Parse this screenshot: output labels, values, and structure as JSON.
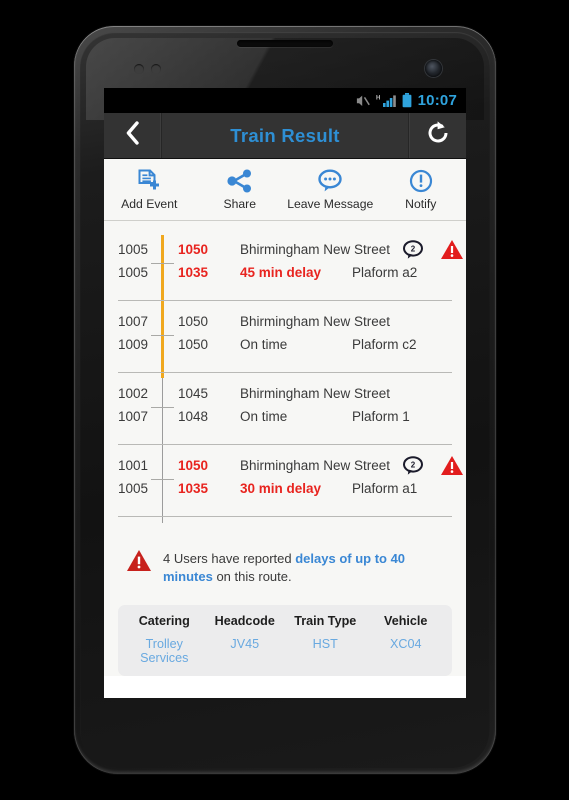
{
  "status_bar": {
    "mute_icon": "mute-icon",
    "signal_icon": "signal-bars-h-icon",
    "battery_icon": "battery-icon",
    "clock": "10:07"
  },
  "nav_bar": {
    "back_icon": "chevron-left-icon",
    "title": "Train Result",
    "refresh_icon": "refresh-icon"
  },
  "toolbar": {
    "items": [
      {
        "label": "Add Event",
        "icon": "document-add-icon"
      },
      {
        "label": "Share",
        "icon": "share-icon"
      },
      {
        "label": "Leave Message",
        "icon": "message-bubble-icon"
      },
      {
        "label": "Notify",
        "icon": "alert-circle-icon"
      }
    ]
  },
  "results": [
    {
      "scheduled_arrival": "1005",
      "estimated_arrival": "1050",
      "destination": "Bhirmingham New Street",
      "scheduled_departure": "1005",
      "estimated_departure": "1035",
      "status": "45 min delay",
      "platform": "Plaform a2",
      "delayed": true,
      "message_count": "2",
      "has_warning": true
    },
    {
      "scheduled_arrival": "1007",
      "estimated_arrival": "1050",
      "destination": "Bhirmingham New Street",
      "scheduled_departure": "1009",
      "estimated_departure": "1050",
      "status": "On time",
      "platform": "Plaform c2",
      "delayed": false,
      "message_count": "",
      "has_warning": false
    },
    {
      "scheduled_arrival": "1002",
      "estimated_arrival": "1045",
      "destination": "Bhirmingham New Street",
      "scheduled_departure": "1007",
      "estimated_departure": "1048",
      "status": "On time",
      "platform": "Plaform 1",
      "delayed": false,
      "message_count": "",
      "has_warning": false
    },
    {
      "scheduled_arrival": "1001",
      "estimated_arrival": "1050",
      "destination": "Bhirmingham New Street",
      "scheduled_departure": "1005",
      "estimated_departure": "1035",
      "status": "30 min delay",
      "platform": "Plaform a1",
      "delayed": true,
      "message_count": "2",
      "has_warning": true
    }
  ],
  "alert": {
    "icon": "warning-triangle-icon",
    "text_before": "4 Users have reported ",
    "highlight": "delays of up to 40 minutes",
    "text_after": " on this route."
  },
  "info_table": {
    "headers": [
      "Catering",
      "Headcode",
      "Train Type",
      "Vehicle"
    ],
    "values": [
      "Trolley Services",
      "JV45",
      "HST",
      "XC04"
    ]
  },
  "colors": {
    "accent_blue": "#3a87d4",
    "nav_title_blue": "#2e8fd4",
    "alert_red": "#e8241f",
    "timeline_orange": "#f0a81e",
    "status_clock_blue": "#2fa3dd",
    "value_blue": "#69a9e0"
  }
}
